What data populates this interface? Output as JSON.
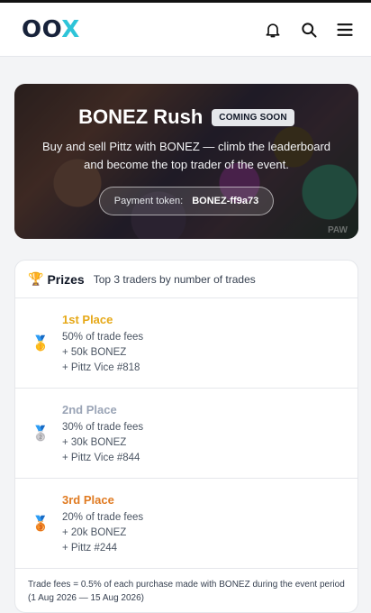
{
  "header": {
    "logo_o": "OO",
    "logo_x": "X",
    "icons": [
      "bell-icon",
      "search-icon",
      "menu-icon"
    ]
  },
  "banner": {
    "title": "BONEZ Rush",
    "badge": "COMING SOON",
    "subtitle": "Buy and sell Pittz with BONEZ — climb the leaderboard and become the top trader of the event.",
    "token_label": "Payment token:",
    "token_value": "BONEZ-ff9a73",
    "watermark": "PAW"
  },
  "prizes": {
    "title": "Prizes",
    "description": "Top 3 traders by number of trades",
    "places": [
      {
        "name": "1st Place",
        "medal": "🥇",
        "lines": [
          "50% of trade fees",
          "+ 50k BONEZ",
          "+ Pittz Vice #818"
        ]
      },
      {
        "name": "2nd Place",
        "medal": "🥈",
        "lines": [
          "30% of trade fees",
          "+ 30k BONEZ",
          "+ Pittz Vice #844"
        ]
      },
      {
        "name": "3rd Place",
        "medal": "🥉",
        "lines": [
          "20% of trade fees",
          "+ 20k BONEZ",
          "+ Pittz #244"
        ]
      }
    ],
    "footnote": "Trade fees = 0.5% of each purchase made with BONEZ during the event period (1 Aug 2026 — 15 Aug 2026)"
  },
  "colors": {
    "accent": "#2ec4d8",
    "logo_dark": "#17223a",
    "gold": "#e6a817",
    "silver": "#9aa4b6",
    "bronze": "#e07b22"
  }
}
